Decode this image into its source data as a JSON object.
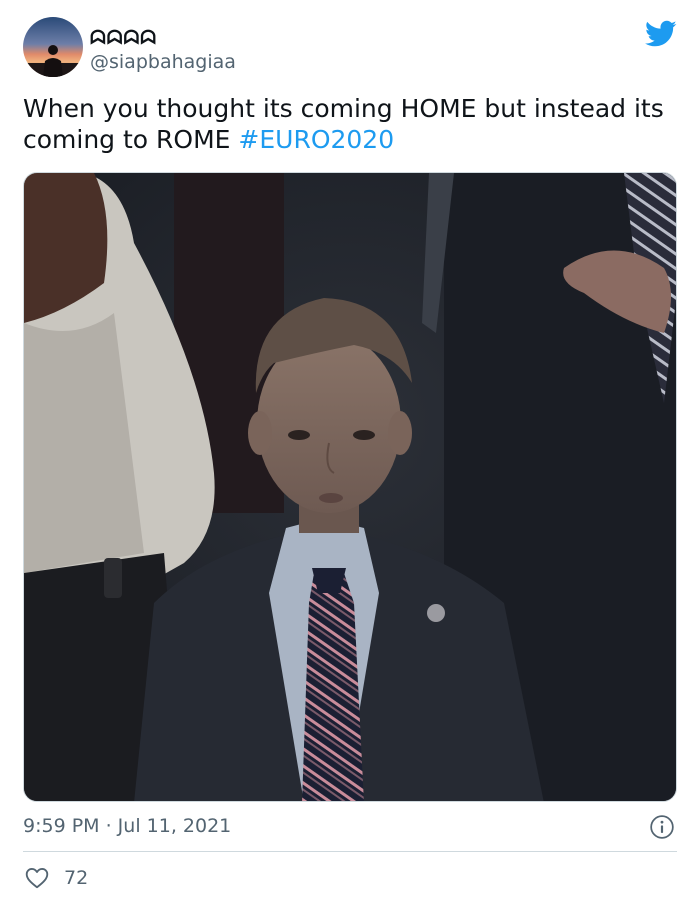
{
  "author": {
    "display_name": "ᗣᗣᗣᗣ",
    "handle": "@siapbahagiaa"
  },
  "tweet": {
    "text": "When you thought its coming HOME but instead its coming to ROME ",
    "hashtag": "#EURO2020",
    "timestamp": "9:59 PM · Jul 11, 2021"
  },
  "engagement": {
    "likes": "72"
  },
  "icons": {
    "brand": "twitter-bird-icon",
    "info": "info-icon",
    "like": "heart-icon"
  },
  "colors": {
    "accent": "#1d9bf0",
    "text": "#0f1419",
    "secondary": "#536471",
    "border": "#cfd9de"
  }
}
